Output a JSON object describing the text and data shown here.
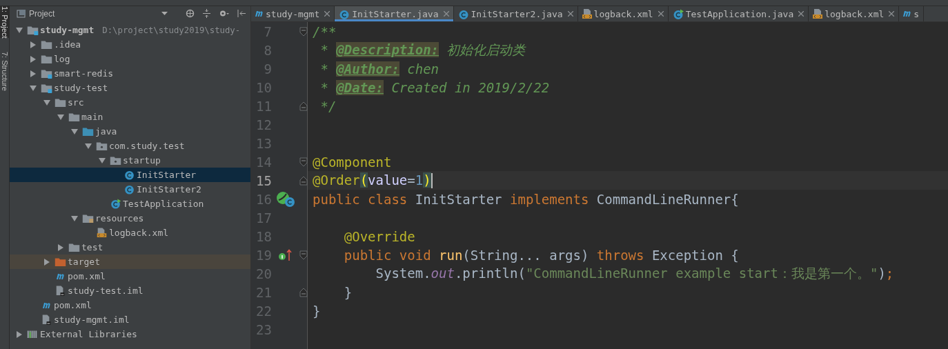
{
  "tool_strip": [
    {
      "label": "1: Project",
      "selected": true
    },
    {
      "label": "7: Structure",
      "selected": false
    }
  ],
  "project_panel": {
    "title": "Project",
    "tree": [
      {
        "label": "study-mgmt",
        "detail": "D:\\project\\study2019\\study-",
        "kind": "module",
        "expanded": true,
        "selected": false,
        "children": [
          {
            "label": ".idea",
            "kind": "folder",
            "expanded": false,
            "selected": false
          },
          {
            "label": "log",
            "kind": "folder",
            "expanded": false,
            "selected": false
          },
          {
            "label": "smart-redis",
            "kind": "module",
            "expanded": false,
            "selected": false
          },
          {
            "label": "study-test",
            "kind": "module",
            "expanded": true,
            "selected": false,
            "children": [
              {
                "label": "src",
                "kind": "folder",
                "expanded": true,
                "selected": false,
                "children": [
                  {
                    "label": "main",
                    "kind": "folder",
                    "expanded": true,
                    "selected": false,
                    "children": [
                      {
                        "label": "java",
                        "kind": "source-folder",
                        "expanded": true,
                        "selected": false,
                        "children": [
                          {
                            "label": "com.study.test",
                            "kind": "package",
                            "expanded": true,
                            "selected": false,
                            "children": [
                              {
                                "label": "startup",
                                "kind": "package",
                                "expanded": true,
                                "selected": false,
                                "children": [
                                  {
                                    "label": "InitStarter",
                                    "kind": "class",
                                    "selected": true
                                  },
                                  {
                                    "label": "InitStarter2",
                                    "kind": "class",
                                    "selected": false
                                  }
                                ]
                              },
                              {
                                "label": "TestApplication",
                                "kind": "boot-class",
                                "selected": false
                              }
                            ]
                          }
                        ]
                      },
                      {
                        "label": "resources",
                        "kind": "resource-folder",
                        "expanded": true,
                        "selected": false,
                        "children": [
                          {
                            "label": "logback.xml",
                            "kind": "xml",
                            "selected": false
                          }
                        ]
                      }
                    ]
                  },
                  {
                    "label": "test",
                    "kind": "folder",
                    "expanded": false,
                    "selected": false
                  }
                ]
              },
              {
                "label": "target",
                "kind": "excluded-folder",
                "expanded": false,
                "selected": false
              },
              {
                "label": "pom.xml",
                "kind": "maven",
                "selected": false
              },
              {
                "label": "study-test.iml",
                "kind": "iml",
                "selected": false
              }
            ]
          },
          {
            "label": "pom.xml",
            "kind": "maven",
            "selected": false
          },
          {
            "label": "study-mgmt.iml",
            "kind": "iml",
            "selected": false
          }
        ]
      },
      {
        "label": "External Libraries",
        "kind": "libraries",
        "expanded": false,
        "selected": false
      }
    ]
  },
  "tabs": [
    {
      "label": "study-mgmt",
      "kind": "maven",
      "selected": false
    },
    {
      "label": "InitStarter.java",
      "kind": "class",
      "selected": true
    },
    {
      "label": "InitStarter2.java",
      "kind": "class",
      "selected": false
    },
    {
      "label": "logback.xml",
      "kind": "xml",
      "selected": false
    },
    {
      "label": "TestApplication.java",
      "kind": "boot-class",
      "selected": false
    },
    {
      "label": "logback.xml",
      "kind": "xml",
      "selected": false
    },
    {
      "label": "s",
      "kind": "maven",
      "selected": false
    }
  ],
  "editor": {
    "lines": [
      {
        "number": "7",
        "current": false,
        "gutter": [
          {
            "kind": "fold-start"
          }
        ],
        "tokens": [
          {
            "kind": "comment",
            "text": "/**"
          }
        ]
      },
      {
        "number": "8",
        "current": false,
        "tokens": [
          {
            "kind": "comment",
            "text": " * "
          },
          {
            "kind": "doctag",
            "text": "@Description:"
          },
          {
            "kind": "comment",
            "text": " 初始化启动类"
          }
        ]
      },
      {
        "number": "9",
        "current": false,
        "tokens": [
          {
            "kind": "comment",
            "text": " * "
          },
          {
            "kind": "doctag",
            "text": "@Author:"
          },
          {
            "kind": "comment",
            "text": " chen"
          }
        ]
      },
      {
        "number": "10",
        "current": false,
        "tokens": [
          {
            "kind": "comment",
            "text": " * "
          },
          {
            "kind": "doctag",
            "text": "@Date:"
          },
          {
            "kind": "comment",
            "text": " Created in 2019/2/22"
          }
        ]
      },
      {
        "number": "11",
        "current": false,
        "gutter": [
          {
            "kind": "fold-end"
          }
        ],
        "tokens": [
          {
            "kind": "comment",
            "text": " */"
          }
        ]
      },
      {
        "number": "12",
        "current": false
      },
      {
        "number": "13",
        "current": false
      },
      {
        "number": "14",
        "current": false,
        "gutter": [
          {
            "kind": "fold-start"
          }
        ],
        "tokens": [
          {
            "kind": "annotation",
            "text": "@Component"
          }
        ]
      },
      {
        "number": "15",
        "current": true,
        "gutter": [
          {
            "kind": "fold-end"
          }
        ],
        "tokens": [
          {
            "kind": "annotation",
            "text": "@Order"
          },
          {
            "kind": "brace",
            "text": "("
          },
          {
            "kind": "param",
            "text": "value"
          },
          {
            "kind": "plain",
            "text": "="
          },
          {
            "kind": "number",
            "text": "1"
          },
          {
            "kind": "brace",
            "text": ")"
          }
        ]
      },
      {
        "number": "16",
        "current": false,
        "gutter": [
          {
            "kind": "bean"
          }
        ],
        "tokens": [
          {
            "kind": "keyword",
            "text": "public class "
          },
          {
            "kind": "plain",
            "text": "InitStarter "
          },
          {
            "kind": "keyword",
            "text": "implements "
          },
          {
            "kind": "plain",
            "text": "CommandLineRunner{"
          }
        ]
      },
      {
        "number": "17",
        "current": false
      },
      {
        "number": "18",
        "current": false,
        "tokens": [
          {
            "kind": "annotation",
            "text": "    @Override"
          }
        ]
      },
      {
        "number": "19",
        "current": false,
        "gutter": [
          {
            "kind": "implements"
          },
          {
            "kind": "fold-start"
          }
        ],
        "tokens": [
          {
            "kind": "keyword",
            "text": "    public void "
          },
          {
            "kind": "method",
            "text": "run"
          },
          {
            "kind": "plain",
            "text": "(String... args) "
          },
          {
            "kind": "keyword",
            "text": "throws "
          },
          {
            "kind": "plain",
            "text": "Exception {"
          }
        ]
      },
      {
        "number": "20",
        "current": false,
        "tokens": [
          {
            "kind": "plain",
            "text": "        System."
          },
          {
            "kind": "field",
            "text": "out"
          },
          {
            "kind": "plain",
            "text": ".println("
          },
          {
            "kind": "string",
            "text": "\"CommandLineRunner example start：我是第一个。\""
          },
          {
            "kind": "plain",
            "text": ")"
          },
          {
            "kind": "keyword",
            "text": ";"
          }
        ]
      },
      {
        "number": "21",
        "current": false,
        "gutter": [
          {
            "kind": "fold-end"
          }
        ],
        "tokens": [
          {
            "kind": "plain",
            "text": "    }"
          }
        ]
      },
      {
        "number": "22",
        "current": false,
        "tokens": [
          {
            "kind": "plain",
            "text": "}"
          }
        ]
      },
      {
        "number": "23",
        "current": false
      }
    ]
  }
}
